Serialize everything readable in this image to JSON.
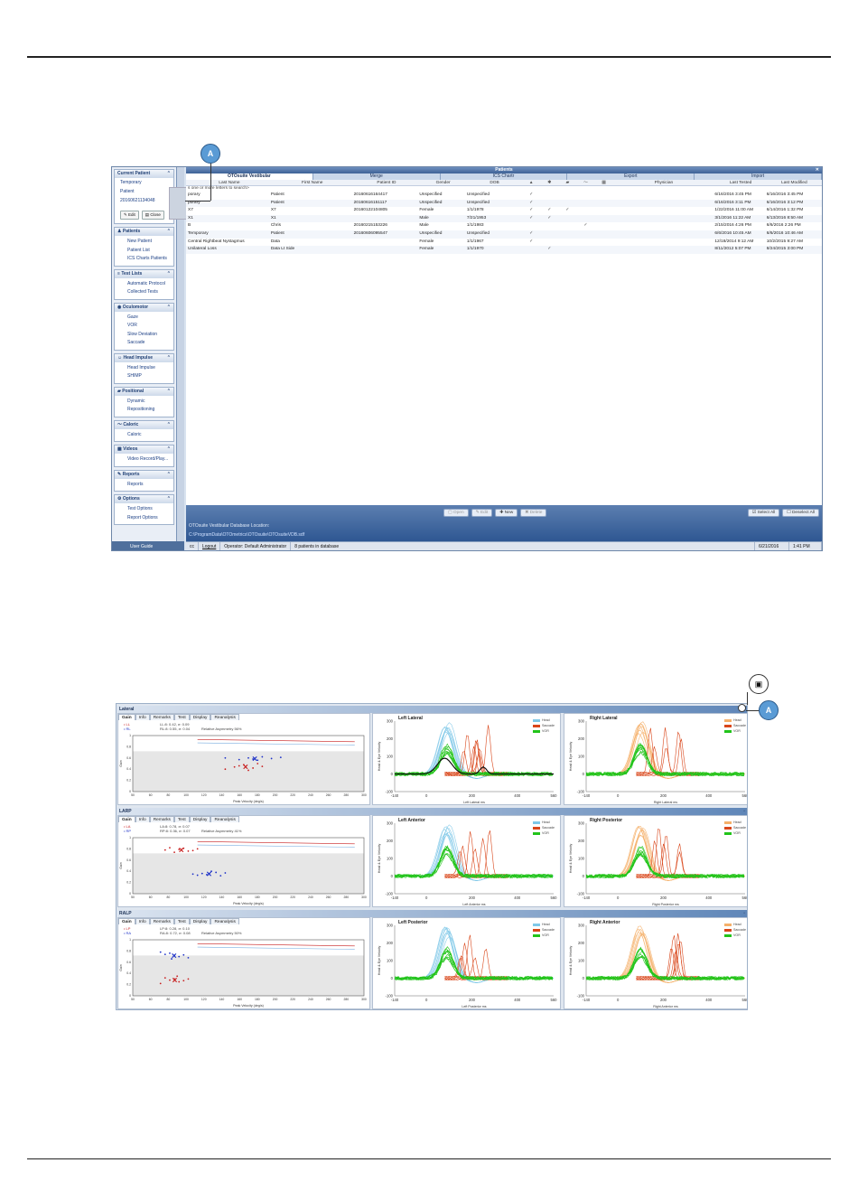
{
  "screenshot1": {
    "window_title": "Patients",
    "tabs": [
      "OTOsuite Vestibular",
      "Merge",
      "ICS Chartr",
      "Export",
      "Import"
    ],
    "current_patient": {
      "header": "Current Patient",
      "items": [
        "Temporary",
        "Patient",
        "20160621134048"
      ],
      "edit_label": "Edit",
      "close_label": "Close"
    },
    "sidebar_groups": [
      {
        "title": "Patients",
        "items": [
          "New Patient",
          "Patient List",
          "ICS Charts Patients"
        ]
      },
      {
        "title": "Test Lists",
        "items": [
          "Automatic Protocol",
          "Collected Tests"
        ]
      },
      {
        "title": "Oculomotor",
        "items": [
          "Gaze",
          "VOR",
          "Slow Deviation",
          "Saccade"
        ]
      },
      {
        "title": "Head Impulse",
        "items": [
          "Head Impulse",
          "SHIMP"
        ]
      },
      {
        "title": "Positional",
        "items": [
          "Dynamic",
          "Repositioning"
        ]
      },
      {
        "title": "Caloric",
        "items": [
          "Caloric"
        ]
      },
      {
        "title": "Videos",
        "items": [
          "Video Record/Play..."
        ]
      },
      {
        "title": "Reports",
        "items": [
          "Reports"
        ]
      },
      {
        "title": "Options",
        "items": [
          "Test Options",
          "Report Options"
        ]
      }
    ],
    "user_guide": "User Guide",
    "columns": [
      "Last Name",
      "First Name",
      "Patient ID",
      "Gender",
      "DOB",
      "Physician",
      "Last Tested",
      "Last Modified"
    ],
    "search_hint": "s one or more letters to search>",
    "rows": [
      {
        "last": "porary",
        "first": "Patient",
        "id": "20160616164417",
        "gender": "Unspecified",
        "dob": "Unspecified",
        "checks": [
          true,
          false,
          false,
          false,
          false
        ],
        "tested": "6/16/2016 3:45 PM",
        "modified": "6/16/2016 3:45 PM"
      },
      {
        "last": "porary",
        "first": "Patient",
        "id": "20160616151117",
        "gender": "Unspecified",
        "dob": "Unspecified",
        "checks": [
          true,
          false,
          false,
          false,
          false
        ],
        "tested": "6/16/2016 3:11 PM",
        "modified": "6/16/2016 3:12 PM"
      },
      {
        "last": "X7",
        "first": "X7",
        "id": "20160122104805",
        "gender": "Female",
        "dob": "1/1/1978",
        "checks": [
          true,
          true,
          true,
          false,
          false
        ],
        "tested": "1/22/2016 11:00 AM",
        "modified": "6/14/2016 1:32 PM"
      },
      {
        "last": "X1",
        "first": "X1",
        "id": "",
        "gender": "Male",
        "dob": "7/21/1953",
        "checks": [
          true,
          true,
          false,
          false,
          false
        ],
        "tested": "3/1/2016 11:22 AM",
        "modified": "6/13/2016 8:50 AM"
      },
      {
        "last": "B",
        "first": "Chris",
        "id": "20160215153226",
        "gender": "Male",
        "dob": "1/1/1983",
        "checks": [
          false,
          false,
          false,
          true,
          false
        ],
        "tested": "2/15/2016 4:26 PM",
        "modified": "6/6/2016 2:26 PM"
      },
      {
        "last": "Temporary",
        "first": "Patient",
        "id": "20160606095547",
        "gender": "Unspecified",
        "dob": "Unspecified",
        "checks": [
          true,
          false,
          false,
          false,
          false
        ],
        "tested": "6/6/2016 10:45 AM",
        "modified": "6/6/2016 10:46 AM"
      },
      {
        "last": "Central Rightbeat Nystagmus",
        "first": "Data",
        "id": "",
        "gender": "Female",
        "dob": "1/1/1967",
        "checks": [
          true,
          false,
          false,
          false,
          false
        ],
        "tested": "12/18/2014 9:12 AM",
        "modified": "10/2/2015 9:27 AM"
      },
      {
        "last": "Unilateral Loss",
        "first": "Data Lt Side",
        "id": "",
        "gender": "Female",
        "dob": "1/1/1970",
        "checks": [
          false,
          true,
          false,
          false,
          false
        ],
        "tested": "8/11/2012 5:07 PM",
        "modified": "8/24/2015 3:00 PM"
      }
    ],
    "buttons": {
      "open": "Open",
      "edit": "Edit",
      "new": "New",
      "delete": "Delete",
      "select_all": "Select All",
      "deselect_all": "Deselect All"
    },
    "db_label": "OTOsuite Vestibular Database Location:",
    "db_path": "C:\\ProgramData\\OTOmetrics\\OTOsuite\\OTOsuiteVDB.sdf",
    "status": {
      "cc": "cc",
      "logout": "Logout",
      "operator": "Operator: Default Administrator",
      "count": "8 patients in database",
      "date": "6/21/2016",
      "time": "1:41 PM"
    },
    "callout": "A"
  },
  "screenshot2": {
    "callout": "A",
    "gain_tabs": [
      "Gain",
      "Info",
      "Remarks",
      "Test",
      "Display",
      "Reanalysis"
    ],
    "panels": [
      {
        "name": "Lateral",
        "legend": [
          "LL",
          "RL"
        ],
        "stats": [
          "LL:8: 0.42, σ: 0.09",
          "RL:8: 0.55, σ: 0.04"
        ],
        "asymmetry": "Relative Asymmetry 56%",
        "left_title": "Left Lateral",
        "right_title": "Right Lateral",
        "left_xlabel": "Left Lateral ms",
        "right_xlabel": "Right Lateral ms"
      },
      {
        "name": "LARP",
        "legend": [
          "LA",
          "RP"
        ],
        "stats": [
          "LA:8: 0.78, σ: 0.07",
          "RP:8: 0.36, σ: 0.07"
        ],
        "asymmetry": "Relative Asymmetry 41%",
        "left_title": "Left Anterior",
        "right_title": "Right Posterior",
        "left_xlabel": "Left Anterior ms",
        "right_xlabel": "Right Posterior ms"
      },
      {
        "name": "RALP",
        "legend": [
          "LP",
          "RA"
        ],
        "stats": [
          "LP:8: 0.28, σ: 0.10",
          "RA:8: 0.72, σ: 0.08"
        ],
        "asymmetry": "Relative Asymmetry 50%",
        "left_title": "Left Posterior",
        "right_title": "Right Anterior",
        "left_xlabel": "Left Posterior ms",
        "right_xlabel": "Right Anterior ms"
      }
    ],
    "gain_axis": {
      "xlabel": "Peak Velocity (deg/s)",
      "ylabel": "Gain",
      "xticks": [
        "50",
        "60",
        "80",
        "100",
        "120",
        "140",
        "160",
        "180",
        "200",
        "220",
        "240",
        "260",
        "280",
        "300"
      ],
      "yticks": [
        "1",
        "0.8",
        "0.6",
        "0.4",
        "0.2",
        "0"
      ]
    },
    "hp_axis": {
      "ylabel": "Head & Eye Velocity",
      "yticks": [
        "300",
        "200",
        "100",
        "0",
        "-100"
      ],
      "xticks": [
        "-140",
        "0",
        "200",
        "400",
        "560"
      ]
    },
    "legend_labels": [
      "Head",
      "Saccade",
      "VOR"
    ],
    "colors": {
      "left_head": "#7ec8e8",
      "right_head": "#f5b06a",
      "saccade": "#d9461a",
      "vor": "#22c41a",
      "gain_left": "#c81e1e",
      "gain_right": "#1e32c8"
    }
  },
  "chart_data": [
    {
      "type": "scatter",
      "title": "Lateral",
      "xlabel": "Peak Velocity (deg/s)",
      "ylabel": "Gain",
      "xlim": [
        50,
        300
      ],
      "ylim": [
        0,
        1
      ],
      "series": [
        {
          "name": "LL",
          "points": [
            [
              160,
              0.44
            ],
            [
              170,
              0.48
            ],
            [
              180,
              0.42
            ],
            [
              175,
              0.38
            ],
            [
              190,
              0.45
            ],
            [
              150,
              0.4
            ],
            [
              185,
              0.5
            ],
            [
              165,
              0.46
            ]
          ]
        },
        {
          "name": "RL",
          "points": [
            [
              175,
              0.6
            ],
            [
              180,
              0.58
            ],
            [
              190,
              0.62
            ],
            [
              165,
              0.57
            ],
            [
              200,
              0.59
            ],
            [
              150,
              0.6
            ],
            [
              210,
              0.61
            ],
            [
              185,
              0.56
            ]
          ]
        }
      ]
    },
    {
      "type": "scatter",
      "title": "LARP",
      "xlabel": "Peak Velocity (deg/s)",
      "ylabel": "Gain",
      "xlim": [
        50,
        300
      ],
      "ylim": [
        0,
        1
      ],
      "series": [
        {
          "name": "LA",
          "points": [
            [
              100,
              0.79
            ],
            [
              90,
              0.82
            ],
            [
              110,
              0.76
            ],
            [
              95,
              0.74
            ],
            [
              120,
              0.8
            ],
            [
              85,
              0.78
            ],
            [
              105,
              0.81
            ],
            [
              115,
              0.77
            ]
          ]
        },
        {
          "name": "RP",
          "points": [
            [
              125,
              0.36
            ],
            [
              130,
              0.34
            ],
            [
              140,
              0.38
            ],
            [
              120,
              0.33
            ],
            [
              150,
              0.37
            ],
            [
              135,
              0.4
            ],
            [
              115,
              0.35
            ],
            [
              145,
              0.32
            ]
          ]
        }
      ]
    },
    {
      "type": "scatter",
      "title": "RALP",
      "xlabel": "Peak Velocity (deg/s)",
      "ylabel": "Gain",
      "xlim": [
        50,
        300
      ],
      "ylim": [
        0,
        1
      ],
      "series": [
        {
          "name": "LP",
          "points": [
            [
              95,
              0.3
            ],
            [
              90,
              0.28
            ],
            [
              100,
              0.25
            ],
            [
              85,
              0.32
            ],
            [
              105,
              0.27
            ],
            [
              80,
              0.22
            ],
            [
              110,
              0.3
            ],
            [
              98,
              0.35
            ]
          ]
        },
        {
          "name": "RA",
          "points": [
            [
              95,
              0.72
            ],
            [
              90,
              0.76
            ],
            [
              100,
              0.7
            ],
            [
              85,
              0.74
            ],
            [
              110,
              0.68
            ],
            [
              80,
              0.78
            ],
            [
              105,
              0.73
            ],
            [
              92,
              0.66
            ]
          ]
        }
      ]
    }
  ]
}
